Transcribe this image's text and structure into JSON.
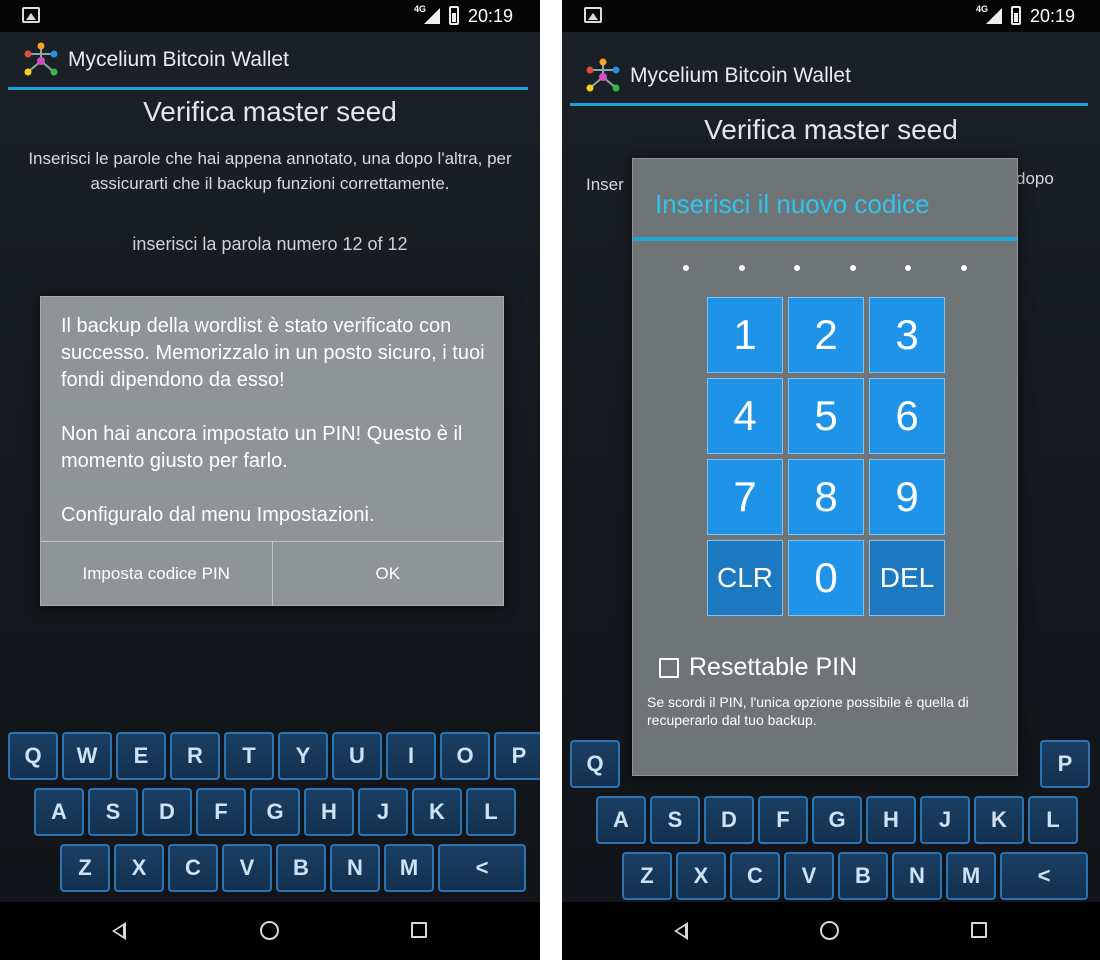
{
  "status": {
    "network": "4G",
    "time": "20:19"
  },
  "app": {
    "title": "Mycelium Bitcoin Wallet"
  },
  "screen": {
    "heading": "Verifica master seed",
    "intro": "Inserisci le parole che hai appena annotato, una dopo l'altra, per assicurarti che il backup funzioni correttamente.",
    "word_prompt": "inserisci la parola numero 12 of 12",
    "intro_fragment_left": "Inser",
    "intro_fragment_right": "dopo"
  },
  "success_dialog": {
    "paragraphs": [
      "Il backup della wordlist è stato verificato con successo. Memorizzalo in un posto sicuro, i tuoi fondi dipendono da esso!",
      "Non hai ancora impostato un PIN! Questo è il momento giusto per farlo.",
      "Configuralo dal menu Impostazioni."
    ],
    "set_pin_label": "Imposta codice PIN",
    "ok_label": "OK"
  },
  "keyboard": {
    "rows": [
      [
        "Q",
        "W",
        "E",
        "R",
        "T",
        "Y",
        "U",
        "I",
        "O",
        "P"
      ],
      [
        "A",
        "S",
        "D",
        "F",
        "G",
        "H",
        "J",
        "K",
        "L"
      ],
      [
        "Z",
        "X",
        "C",
        "V",
        "B",
        "N",
        "M"
      ]
    ],
    "backspace_label": "<",
    "right_visible_row1": [
      "P"
    ],
    "right_visible_row2": [
      "A",
      "S",
      "D",
      "F",
      "G",
      "H",
      "J",
      "K",
      "L"
    ],
    "right_visible_row3": [
      "Z",
      "X",
      "C",
      "V",
      "B",
      "N",
      "M"
    ]
  },
  "pin_dialog": {
    "title": "Inserisci il nuovo codice",
    "dot_count": 6,
    "keys": [
      "1",
      "2",
      "3",
      "4",
      "5",
      "6",
      "7",
      "8",
      "9",
      "CLR",
      "0",
      "DEL"
    ],
    "resettable_label": "Resettable PIN",
    "resettable_checked": false,
    "note": "Se scordi il PIN, l'unica opzione possibile è quella di recuperarlo dal tuo backup."
  },
  "colors": {
    "accent": "#1aa6d9",
    "pin_title": "#2fc3f0",
    "pad_key": "#1e93e8"
  }
}
